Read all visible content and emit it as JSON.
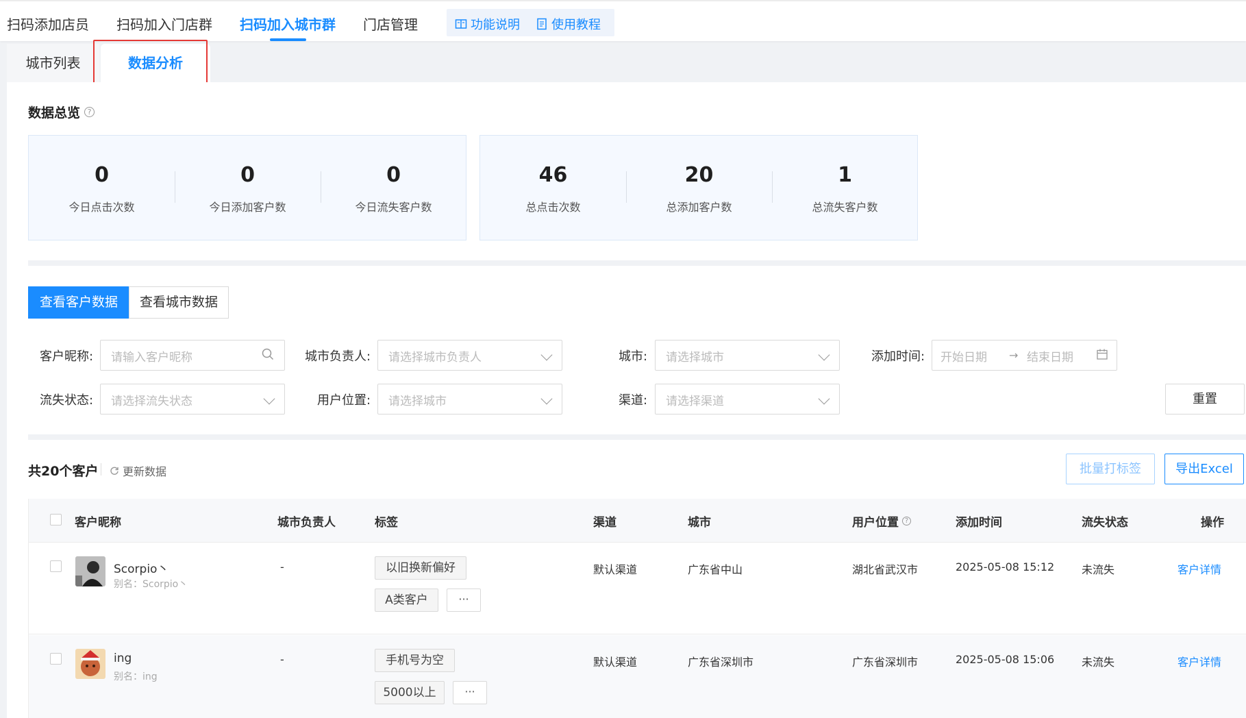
{
  "top_tabs": [
    {
      "label": "扫码添加店员"
    },
    {
      "label": "扫码加入门店群"
    },
    {
      "label": "扫码加入城市群"
    },
    {
      "label": "门店管理"
    }
  ],
  "help_links": [
    {
      "label": "功能说明",
      "icon": "book-icon"
    },
    {
      "label": "使用教程",
      "icon": "document-icon"
    }
  ],
  "sub_tabs": [
    {
      "label": "城市列表"
    },
    {
      "label": "数据分析"
    }
  ],
  "overview": {
    "title": "数据总览",
    "today": [
      {
        "value": "0",
        "label": "今日点击次数"
      },
      {
        "value": "0",
        "label": "今日添加客户数"
      },
      {
        "value": "0",
        "label": "今日流失客户数"
      }
    ],
    "total": [
      {
        "value": "46",
        "label": "总点击次数"
      },
      {
        "value": "20",
        "label": "总添加客户数"
      },
      {
        "value": "1",
        "label": "总流失客户数"
      }
    ]
  },
  "view_switch": {
    "customer": "查看客户数据",
    "city": "查看城市数据"
  },
  "filters": {
    "nickname": {
      "label": "客户昵称:",
      "placeholder": "请输入客户昵称"
    },
    "city_owner": {
      "label": "城市负责人:",
      "placeholder": "请选择城市负责人"
    },
    "city": {
      "label": "城市:",
      "placeholder": "请选择城市"
    },
    "add_time": {
      "label": "添加时间:",
      "start": "开始日期",
      "end": "结束日期",
      "arrow": "→"
    },
    "churn_status": {
      "label": "流失状态:",
      "placeholder": "请选择流失状态"
    },
    "user_location": {
      "label": "用户位置:",
      "placeholder": "请选择城市"
    },
    "channel": {
      "label": "渠道:",
      "placeholder": "请选择渠道"
    },
    "reset": "重置"
  },
  "list": {
    "title": "共20个客户",
    "refresh": "更新数据",
    "batch_tag": "批量打标签",
    "export": "导出Excel"
  },
  "table": {
    "columns": {
      "nickname": "客户昵称",
      "owner": "城市负责人",
      "tags": "标签",
      "channel": "渠道",
      "city": "城市",
      "location": "用户位置",
      "add_time": "添加时间",
      "churn": "流失状态",
      "action": "操作"
    },
    "rows": [
      {
        "nickname": "Scorpio丶",
        "alias": "别名：Scorpio丶",
        "owner": "-",
        "tags": [
          "以旧换新偏好",
          "A类客户"
        ],
        "more": "···",
        "channel": "默认渠道",
        "city": "广东省中山",
        "location": "湖北省武汉市",
        "add_time": "2025-05-08 15:12",
        "churn": "未流失",
        "action": "客户详情"
      },
      {
        "nickname": "ing",
        "alias": "别名：ing",
        "owner": "-",
        "tags": [
          "手机号为空",
          "5000以上"
        ],
        "more": "···",
        "channel": "默认渠道",
        "city": "广东省深圳市",
        "location": "广东省深圳市",
        "add_time": "2025-05-08 15:06",
        "churn": "未流失",
        "action": "客户详情"
      }
    ]
  },
  "colors": {
    "accent": "#1a8cff",
    "highlight": "#e53935"
  }
}
